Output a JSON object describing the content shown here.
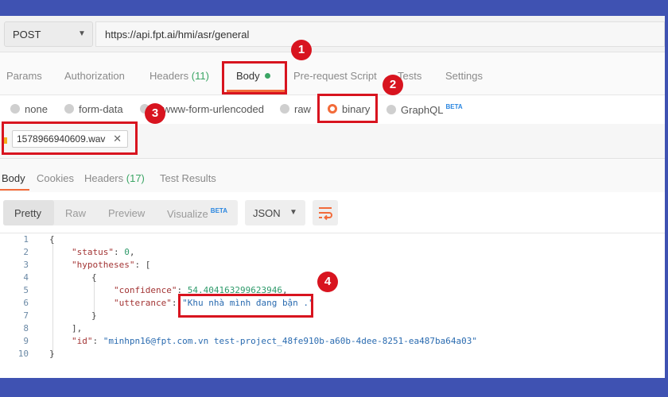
{
  "request": {
    "method": "POST",
    "url": "https://api.fpt.ai/hmi/asr/general"
  },
  "request_tabs": [
    {
      "label": "Params"
    },
    {
      "label": "Authorization"
    },
    {
      "label": "Headers",
      "count": "(11)"
    },
    {
      "label": "Body"
    },
    {
      "label": "Pre-request Script"
    },
    {
      "label": "Tests"
    },
    {
      "label": "Settings"
    }
  ],
  "body_types": {
    "options": [
      "none",
      "form-data",
      "x-www-form-urlencoded",
      "raw",
      "binary",
      "GraphQL"
    ],
    "selected": "binary",
    "beta_label": "BETA"
  },
  "file": {
    "name": "1578966940609.wav",
    "remove_glyph": "✕"
  },
  "response_tabs": [
    {
      "label": "Body"
    },
    {
      "label": "Cookies"
    },
    {
      "label": "Headers",
      "count": "(17)"
    },
    {
      "label": "Test Results"
    }
  ],
  "format": {
    "options": [
      "Pretty",
      "Raw",
      "Preview",
      "Visualize"
    ],
    "visualize_beta": "BETA",
    "language": "JSON"
  },
  "code_lines": [
    {
      "no": "1",
      "text": "{"
    },
    {
      "no": "2",
      "key": "\"status\"",
      "value": "0",
      "tail": ","
    },
    {
      "no": "3",
      "key": "\"hypotheses\"",
      "value": "[",
      "tail": ""
    },
    {
      "no": "4",
      "text": "{"
    },
    {
      "no": "5",
      "key": "\"confidence\"",
      "value": "54.404163299623946",
      "tail": ","
    },
    {
      "no": "6",
      "key": "\"utterance\"",
      "value": "\"Khu nhà mình đang bận .\"",
      "tail": ""
    },
    {
      "no": "7",
      "text": "}"
    },
    {
      "no": "8",
      "text": "],"
    },
    {
      "no": "9",
      "key": "\"id\"",
      "value": "\"minhpn16@fpt.com.vn test-project_48fe910b-a60b-4dee-8251-ea487ba64a03\"",
      "tail": ""
    },
    {
      "no": "10",
      "text": "}"
    }
  ],
  "badges": [
    "1",
    "2",
    "3",
    "4"
  ],
  "colors": {
    "frame": "#3f52b2",
    "accent": "#f26b3a",
    "annotation": "#d8141f",
    "count_green": "#3aa564"
  }
}
